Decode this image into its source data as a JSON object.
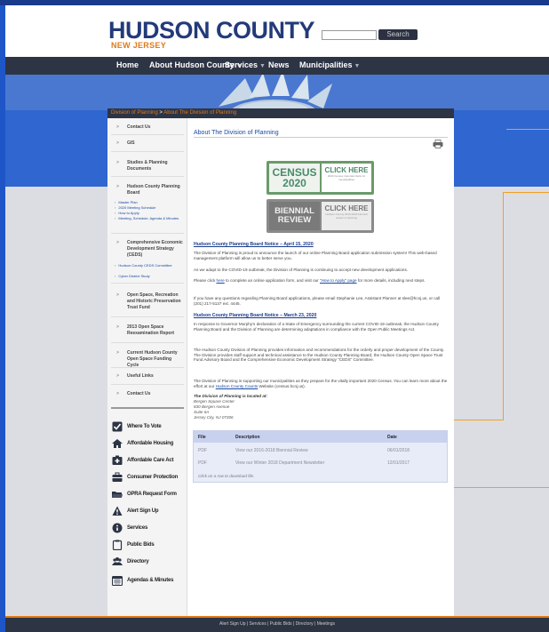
{
  "header": {
    "logo_title": "HUDSON COUNTY",
    "logo_subtitle": "NEW JERSEY",
    "search_button": "Search"
  },
  "nav": {
    "items": [
      "Home",
      "About Hudson County",
      "Services",
      "News",
      "Municipalities"
    ]
  },
  "breadcrumb": {
    "parent": "Division of Planning",
    "separator": ">",
    "current": "About The Division of Planning"
  },
  "sidebar": {
    "items": [
      "Contact Us",
      "GIS",
      "Studies & Planning Documents",
      "Hudson County Planning Board",
      "Comprehensive Economic Development Strategy (CEDS)",
      "Open Space, Recreation and Historic Preservation Trust Fund",
      "2013 Open Space Reexamination Report",
      "Current Hudson County Open Space Funding Cycle",
      "Useful Links",
      "Contact Us"
    ],
    "planning_board_subitems": [
      "Master Plan",
      "2020 Meeting Schedule",
      "How to Apply",
      "Meeting, Schedule, Agenda & Minutes"
    ],
    "ceds_subitems": [
      "Hudson County CEDS Committee",
      "Cyber District Study"
    ]
  },
  "quicklinks": [
    {
      "label": "Where To Vote",
      "icon": "checkbox-icon"
    },
    {
      "label": "Affordable Housing",
      "icon": "house-icon"
    },
    {
      "label": "Affordable Care Act",
      "icon": "medical-cross-icon"
    },
    {
      "label": "Consumer Protection",
      "icon": "briefcase-icon"
    },
    {
      "label": "OPRA Request Form",
      "icon": "folder-icon"
    },
    {
      "label": "Alert Sign Up",
      "icon": "warning-icon"
    },
    {
      "label": "Services",
      "icon": "info-icon"
    },
    {
      "label": "Public Bids",
      "icon": "clipboard-icon"
    },
    {
      "label": "Directory",
      "icon": "people-icon"
    },
    {
      "label": "Agendas & Minutes",
      "icon": "calendar-icon"
    }
  ],
  "main": {
    "title": "About The Division of Planning",
    "census_banner": {
      "left": "CENSUS 2020",
      "cta": "CLICK HERE",
      "tiny": "2020 Census important facts for municipalities"
    },
    "biennial_banner": {
      "left": "BIENNIAL REVIEW",
      "cta": "CLICK HERE",
      "tiny": "Hudson County 2016-2018 biennial review of planning"
    },
    "notice1_heading": "Hudson County Planning Board Notice – April 15, 2020",
    "notice1_p1": "The Division of Planning is proud to announce the launch of our online Planning Board application submission system! This web-based management platform will allow us to better serve you.",
    "notice1_p2": "As we adapt to the COVID-19 outbreak, the Division of Planning is continuing to accept new development applications.",
    "notice1_p3_a": "Please click ",
    "notice1_p3_link1": "here",
    "notice1_p3_b": " to complete an online application form, and visit our ",
    "notice1_p3_link2": "\"How to Apply\" page",
    "notice1_p3_c": " for more details, including next steps.",
    "notice1_p4": "If you have any questions regarding Planning Board applications, please email Stephanie Lee, Assistant Planner at slee@hcnj.us, or call (201) 217-5137 ext. 4445.",
    "notice2_heading": "Hudson County Planning Board Notice – March 23, 2020",
    "notice2_p1": "In response to Governor Murphy's declaration of a State of Emergency surrounding the current COVID-19 outbreak, the Hudson County Planning Board and the Division of Planning are determining adaptations in compliance with the Open Public Meetings Act.",
    "about_p1": "The Hudson County Division of Planning provides information and recommendations for the orderly and proper development of the County. The Division provides staff support and technical assistance to the Hudson County Planning Board, the Hudson County Open Space Trust Fund Advisory Board and the Comprehensive Economic Development Strategy \"CEDS\" Committee.",
    "about_p2_a": "The Division of Planning is supporting our municipalities as they prepare for the vitally important 2020 Census. You can learn more about the effort at our ",
    "about_p2_link": "Hudson County Counts",
    "about_p2_b": " Website (census.hcnj.us).",
    "location_heading": "The Division of Planning is located at:",
    "address": [
      "Bergen Square Center",
      "830 Bergen Avenue",
      "Suite 6A",
      "Jersey City, NJ 07306"
    ]
  },
  "files_table": {
    "headers": [
      "File",
      "Description",
      "Date"
    ],
    "rows": [
      {
        "file": "PDF",
        "description": "View our 2016-2018 Biennial Review",
        "date": "06/01/2018"
      },
      {
        "file": "PDF",
        "description": "View our Winter 2018 Department Newsletter",
        "date": "12/01/2017"
      }
    ],
    "footer": "Click on a row to download file."
  },
  "footer": {
    "links": "Alert Sign Up | Services | Public Bids | Directory | Meetings"
  },
  "colors": {
    "brand_navy": "#233a7a",
    "accent_orange": "#e07a1a",
    "nav_dark": "#2d3444",
    "page_blue": "#1e56c8"
  }
}
